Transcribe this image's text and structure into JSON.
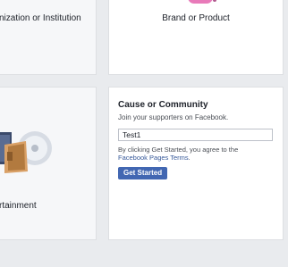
{
  "cards": {
    "organization": {
      "label": "nization or Institution"
    },
    "brand": {
      "label": "Brand or Product"
    },
    "entertainment": {
      "label": "rtainment"
    },
    "cause": {
      "title": "Cause or Community",
      "subtitle": "Join your supporters on Facebook.",
      "page_name_value": "Test1",
      "terms_prefix": "By clicking Get Started, you agree to the",
      "terms_link": "Facebook Pages Terms",
      "terms_suffix": ".",
      "button_label": "Get Started"
    }
  },
  "colors": {
    "background": "#e9ebee",
    "primary_button": "#4267b2",
    "link": "#365899"
  },
  "icons": [
    "brand-product-icon",
    "entertainment-icon"
  ]
}
